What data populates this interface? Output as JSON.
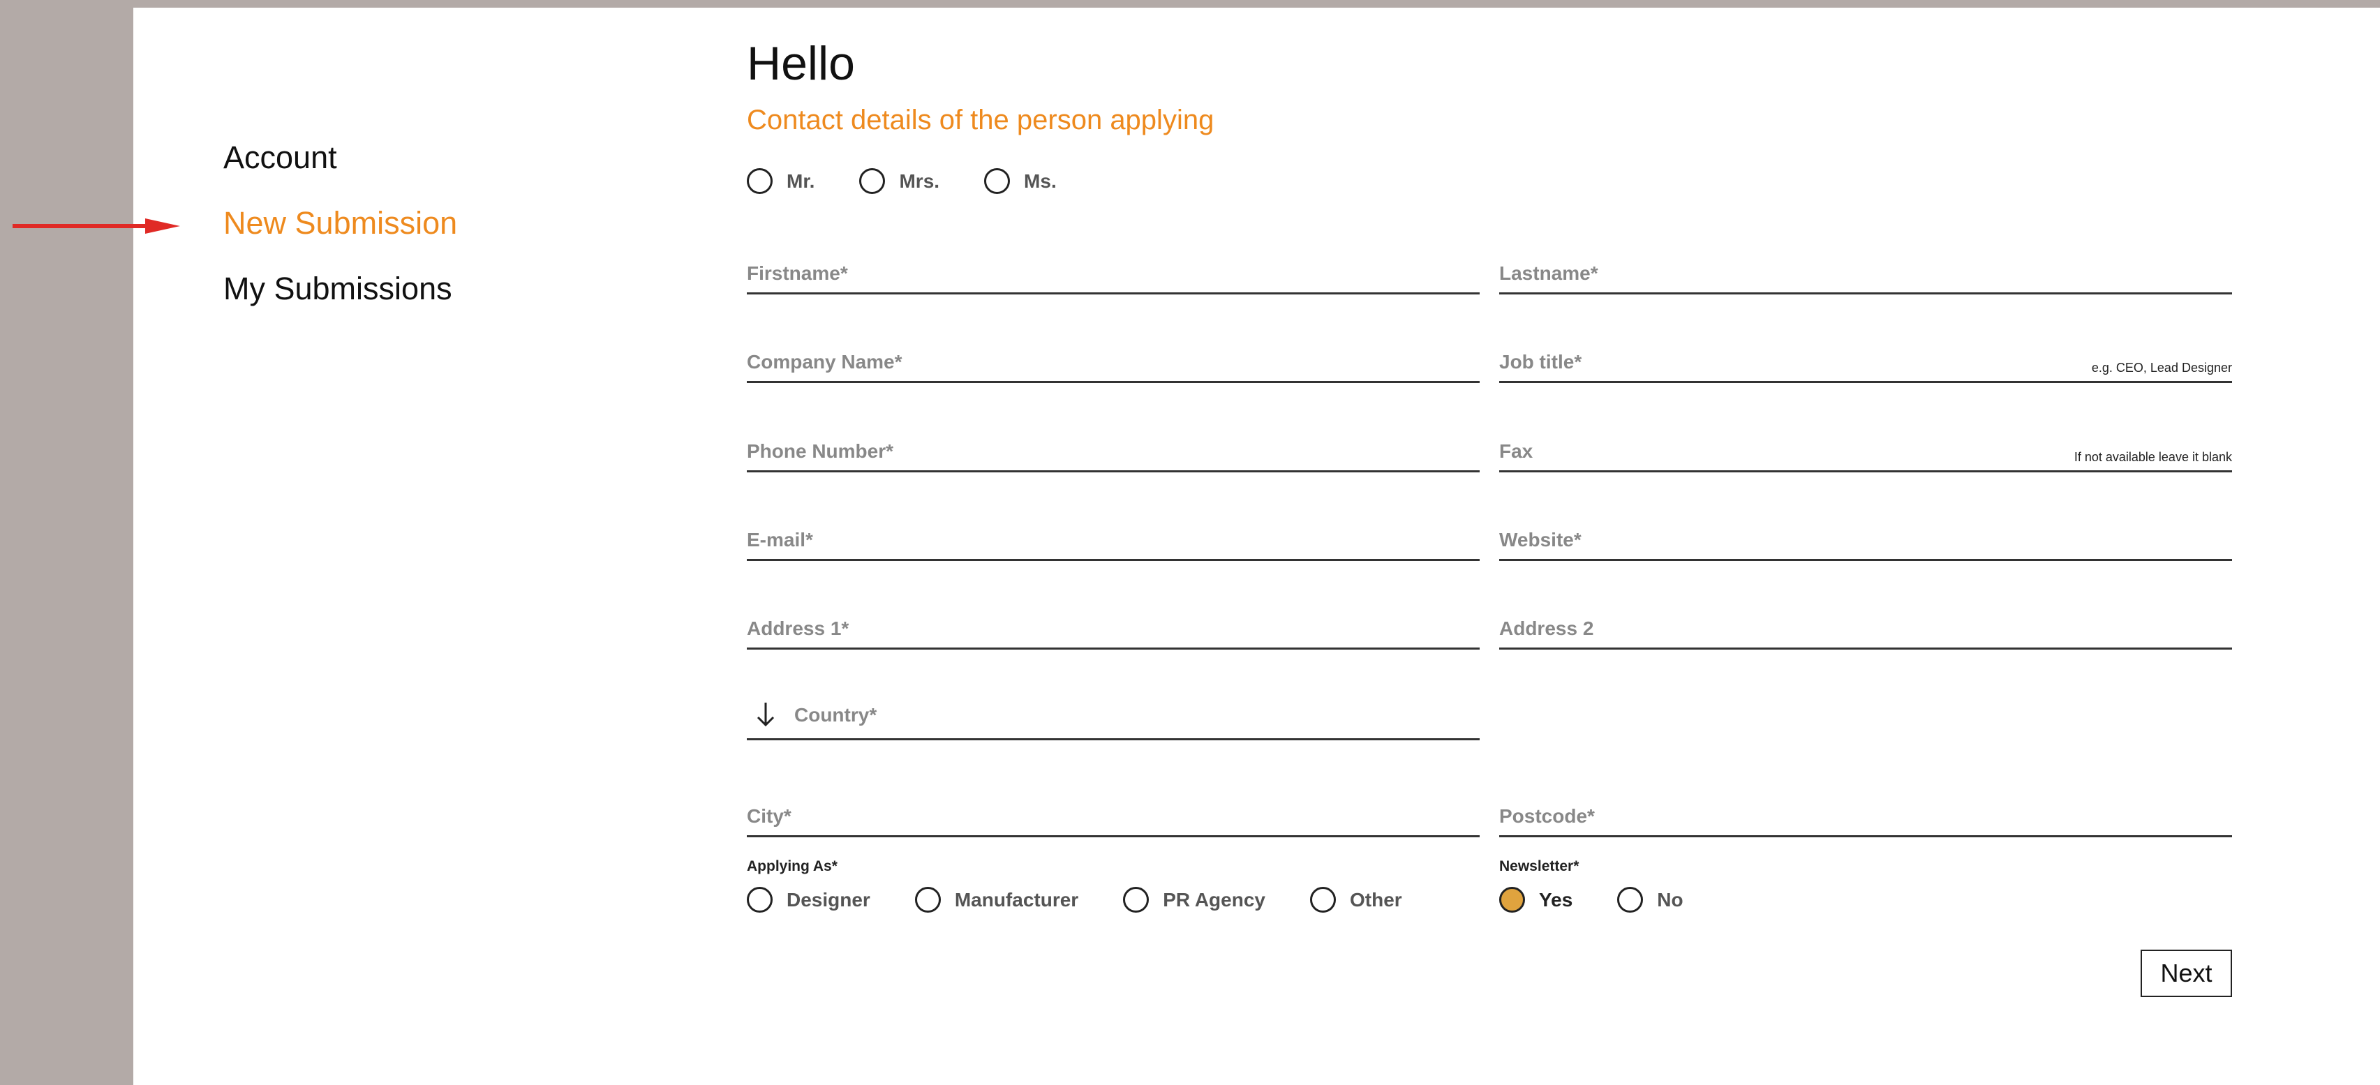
{
  "nav": {
    "account": "Account",
    "new_submission": "New Submission",
    "my_submissions": "My Submissions"
  },
  "form": {
    "title": "Hello",
    "subtitle": "Contact details of the person applying",
    "salutations": [
      "Mr.",
      "Mrs.",
      "Ms."
    ],
    "fields": {
      "firstname": {
        "placeholder": "Firstname*",
        "value": ""
      },
      "lastname": {
        "placeholder": "Lastname*",
        "value": ""
      },
      "company": {
        "placeholder": "Company Name*",
        "value": ""
      },
      "jobtitle": {
        "placeholder": "Job title*",
        "value": "",
        "hint": "e.g. CEO, Lead Designer"
      },
      "phone": {
        "placeholder": "Phone Number*",
        "value": ""
      },
      "fax": {
        "placeholder": "Fax",
        "value": "",
        "hint": "If not available leave it blank"
      },
      "email": {
        "placeholder": "E-mail*",
        "value": ""
      },
      "website": {
        "placeholder": "Website*",
        "value": ""
      },
      "address1": {
        "placeholder": "Address 1*",
        "value": ""
      },
      "address2": {
        "placeholder": "Address 2",
        "value": ""
      },
      "country": {
        "placeholder": "Country*",
        "value": ""
      },
      "city": {
        "placeholder": "City*",
        "value": ""
      },
      "postcode": {
        "placeholder": "Postcode*",
        "value": ""
      }
    },
    "applying_as": {
      "label": "Applying As*",
      "options": [
        "Designer",
        "Manufacturer",
        "PR Agency",
        "Other"
      ]
    },
    "newsletter": {
      "label": "Newsletter*",
      "options": [
        "Yes",
        "No"
      ],
      "selected": "Yes"
    },
    "next_label": "Next"
  },
  "colors": {
    "accent": "#ee8a1e",
    "radio_selected": "#e0a33e",
    "sidebar_bg": "#b3aaa7",
    "annotation_arrow": "#e02a26"
  },
  "icons": {
    "annotation": "arrow-right-icon",
    "country_select": "arrow-down-icon"
  }
}
